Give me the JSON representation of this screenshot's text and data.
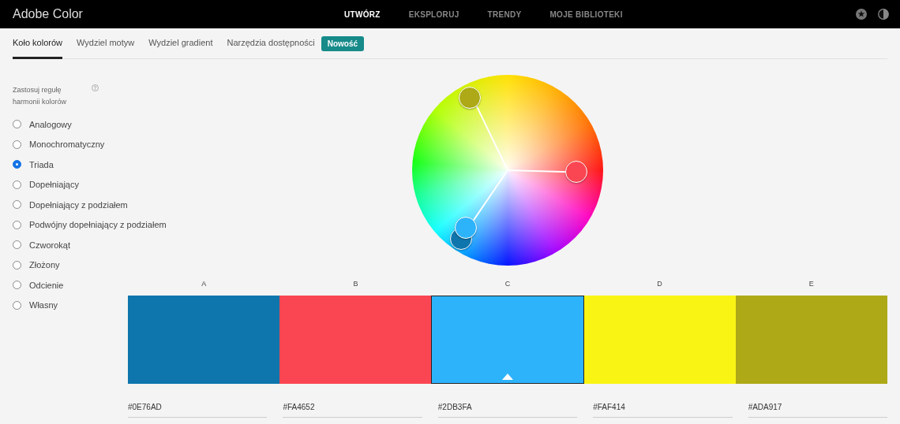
{
  "header": {
    "title": "Adobe Color",
    "nav": [
      {
        "label": "UTWÓRZ",
        "selected": true
      },
      {
        "label": "EKSPLORUJ",
        "selected": false
      },
      {
        "label": "TRENDY",
        "selected": false
      },
      {
        "label": "MOJE BIBLIOTEKI",
        "selected": false
      }
    ]
  },
  "tabs": [
    {
      "label": "Koło kolorów",
      "selected": true
    },
    {
      "label": "Wydziel motyw",
      "selected": false
    },
    {
      "label": "Wydziel gradient",
      "selected": false
    },
    {
      "label": "Narzędzia dostępności",
      "selected": false
    }
  ],
  "new_badge": "Nowość",
  "harmony": {
    "title": "Zastosuj regułę harmonii kolorów",
    "options": [
      {
        "label": "Analogowy",
        "selected": false
      },
      {
        "label": "Monochromatyczny",
        "selected": false
      },
      {
        "label": "Triada",
        "selected": true
      },
      {
        "label": "Dopełniający",
        "selected": false
      },
      {
        "label": "Dopełniający z podziałem",
        "selected": false
      },
      {
        "label": "Podwójny dopełniający z podziałem",
        "selected": false
      },
      {
        "label": "Czworokąt",
        "selected": false
      },
      {
        "label": "Złożony",
        "selected": false
      },
      {
        "label": "Odcienie",
        "selected": false
      },
      {
        "label": "Własny",
        "selected": false
      }
    ]
  },
  "swatches": [
    {
      "label": "A",
      "color": "#0e76ad",
      "hex": "#0E76AD",
      "selected": false
    },
    {
      "label": "B",
      "color": "#fa4652",
      "hex": "#FA4652",
      "selected": false
    },
    {
      "label": "C",
      "color": "#2db3fa",
      "hex": "#2DB3FA",
      "selected": true
    },
    {
      "label": "D",
      "color": "#faf414",
      "hex": "#FAF414",
      "selected": false
    },
    {
      "label": "E",
      "color": "#ada917",
      "hex": "#ADA917",
      "selected": false
    }
  ]
}
